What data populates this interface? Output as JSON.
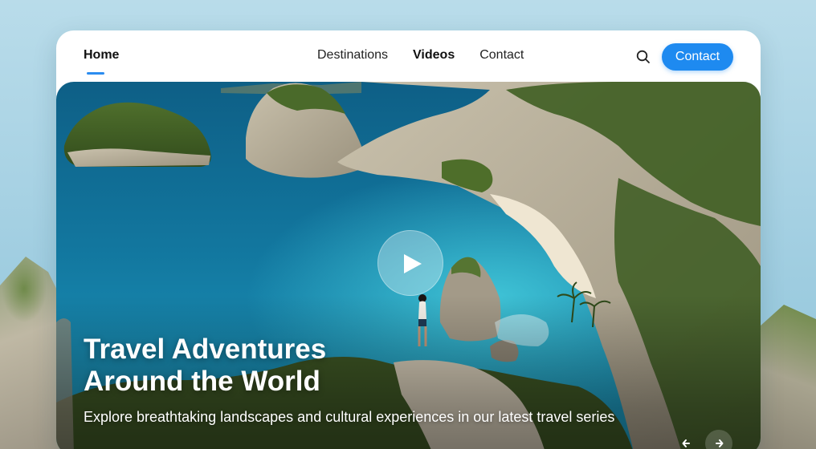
{
  "nav": {
    "home_label": "Home",
    "links": [
      {
        "label": "Destinations",
        "active": false
      },
      {
        "label": "Videos",
        "active": true
      },
      {
        "label": "Contact",
        "active": false
      }
    ],
    "search_icon": "search-icon",
    "contact_button_label": "Contact"
  },
  "hero": {
    "title_line1": "Travel Adventures",
    "title_line2": "Around the World",
    "subtitle": "Explore breathtaking landscapes and cultural experiences in our latest travel series",
    "play_icon": "play-icon",
    "prev_icon": "arrow-left-icon",
    "next_icon": "arrow-right-icon"
  },
  "colors": {
    "accent": "#1e8af0",
    "text": "#111111",
    "sea": "#1a7fa6",
    "white": "#ffffff"
  }
}
